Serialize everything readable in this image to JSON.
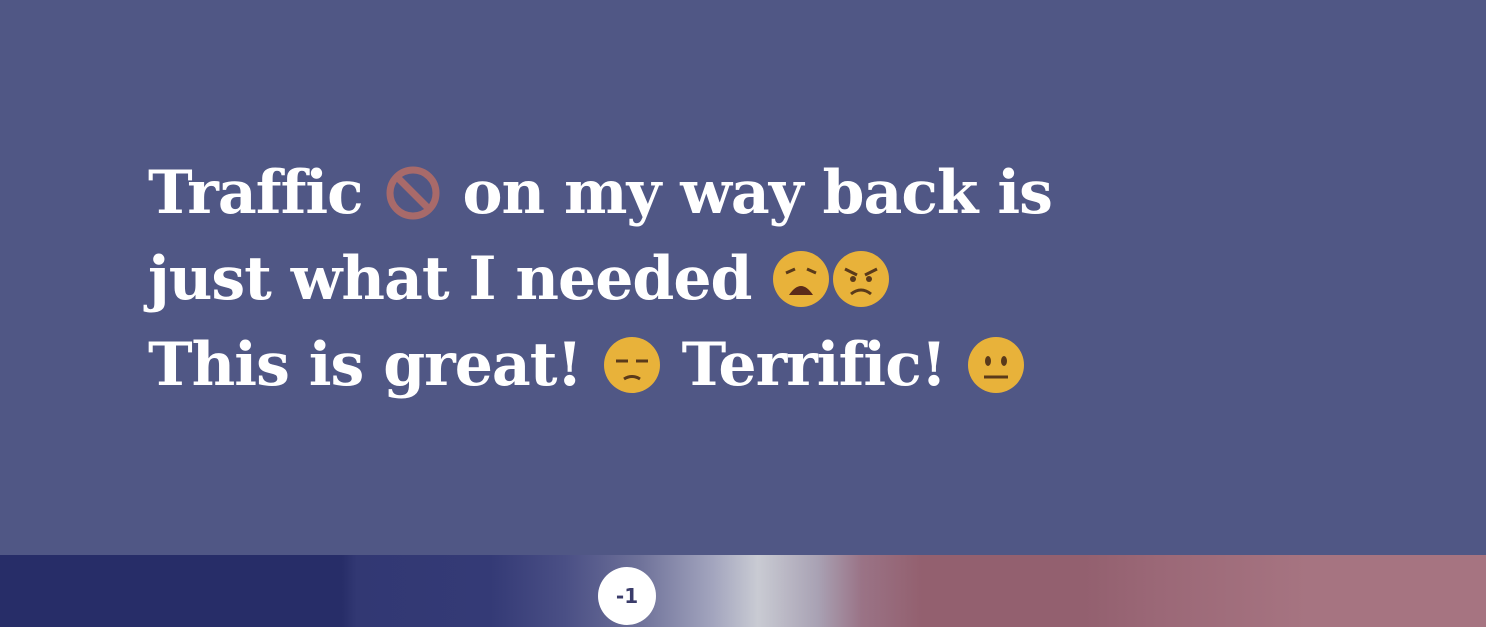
{
  "message": {
    "line1": {
      "a": "Traffic ",
      "emoji1": "no-entry-sign-icon",
      "b": " on my way back is"
    },
    "line2": {
      "a": "just what I needed ",
      "emoji1": "weary-face-icon",
      "emoji2": "angry-face-icon"
    },
    "line3": {
      "a": "This is great! ",
      "emoji1": "unamused-face-icon",
      "b": " Terrific! ",
      "emoji2": "neutral-face-icon"
    }
  },
  "sentiment_scale": {
    "value_label": "-1",
    "colors": {
      "negative": "#272d68",
      "neutral": "#c9cbd3",
      "positive": "#a67481"
    }
  },
  "colors": {
    "background": "#505785",
    "text": "#ffffff"
  }
}
